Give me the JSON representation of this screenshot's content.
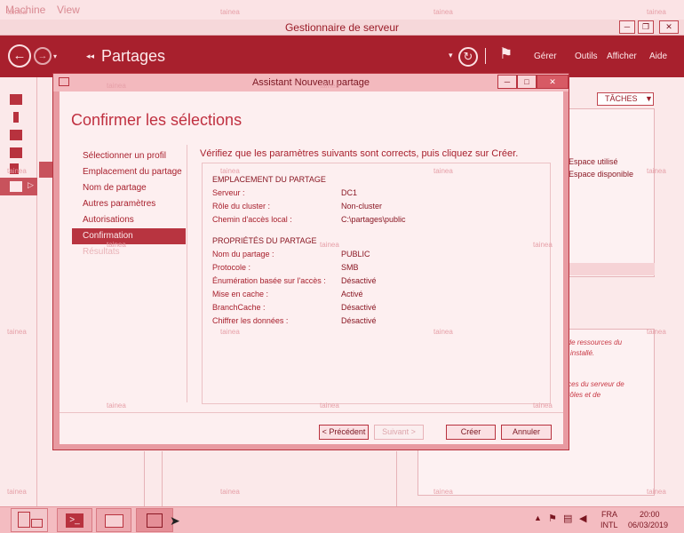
{
  "vm_menu": {
    "machine": "Machine",
    "view": "View"
  },
  "server_manager": {
    "window_title": "Gestionnaire de serveur",
    "page_title": "Partages",
    "header_menu": [
      "Gérer",
      "Outils",
      "Afficher",
      "Aide"
    ],
    "tasks_label": "TÂCHES",
    "right_panel": {
      "used_space": "Espace utilisé",
      "free_space": "Espace disponible",
      "notice1_line1": "e de ressources du",
      "notice1_line2": "installé.",
      "notice2_line1": "urces du serveur de",
      "notice2_line2": "e rôles et de"
    }
  },
  "dialog": {
    "title": "Assistant Nouveau partage",
    "heading": "Confirmer les sélections",
    "steps": [
      {
        "label": "Sélectionner un profil",
        "state": "normal"
      },
      {
        "label": "Emplacement du partage",
        "state": "normal"
      },
      {
        "label": "Nom de partage",
        "state": "normal"
      },
      {
        "label": "Autres paramètres",
        "state": "normal"
      },
      {
        "label": "Autorisations",
        "state": "normal"
      },
      {
        "label": "Confirmation",
        "state": "active"
      },
      {
        "label": "Résultats",
        "state": "disabled"
      }
    ],
    "instruction": "Vérifiez que les paramètres suivants sont corrects, puis cliquez sur Créer.",
    "sections": [
      {
        "title": "EMPLACEMENT DU PARTAGE",
        "rows": [
          {
            "label": "Serveur :",
            "value": "DC1"
          },
          {
            "label": "Rôle du cluster :",
            "value": "Non-cluster"
          },
          {
            "label": "Chemin d'accès local :",
            "value": "C:\\partages\\public"
          }
        ]
      },
      {
        "title": "PROPRIÉTÉS DU PARTAGE",
        "rows": [
          {
            "label": "Nom du partage :",
            "value": "PUBLIC"
          },
          {
            "label": "Protocole :",
            "value": "SMB"
          },
          {
            "label": "Énumération basée sur l'accès :",
            "value": "Désactivé"
          },
          {
            "label": "Mise en cache :",
            "value": "Activé"
          },
          {
            "label": "BranchCache :",
            "value": "Désactivé"
          },
          {
            "label": "Chiffrer les données :",
            "value": "Désactivé"
          }
        ]
      }
    ],
    "buttons": {
      "previous": "< Précédent",
      "next": "Suivant >",
      "create": "Créer",
      "cancel": "Annuler"
    }
  },
  "taskbar": {
    "language": "FRA",
    "layout": "INTL",
    "time": "20:00",
    "date": "06/03/2019"
  },
  "watermark": "tainea",
  "colors": {
    "accent": "#a8202d",
    "background": "#fbe9ea"
  }
}
